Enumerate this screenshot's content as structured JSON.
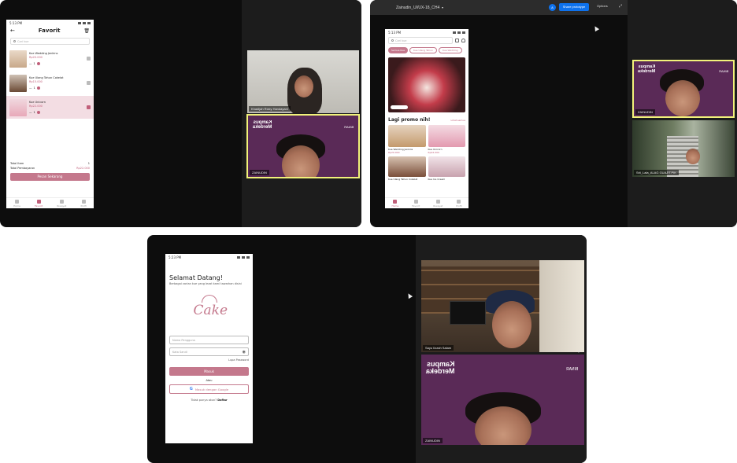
{
  "panel1": {
    "phone": {
      "time": "5:13 PM",
      "title": "Favorit",
      "search_placeholder": "Cari kue",
      "items": [
        {
          "name": "Kue Wedding Jenkins",
          "price": "Rp20.000",
          "qty": "1"
        },
        {
          "name": "Kue Ulang Tahun Cokelat",
          "price": "Rp15.000",
          "qty": "1"
        },
        {
          "name": "Kue Unicorn",
          "price": "Rp22.000",
          "qty": "1"
        }
      ],
      "total_item_label": "Total Item",
      "total_item_value": "1",
      "total_payment_label": "Total Pembayaran",
      "total_payment_value": "Rp22.000",
      "order_button": "Pesan Sekarang",
      "nav": [
        "Home",
        "Favorit",
        "Riwayat",
        "Profil"
      ]
    },
    "cams": [
      {
        "name": "Khadijah Rizky Handayani"
      },
      {
        "name": "ZAINUDIN"
      }
    ]
  },
  "panel2": {
    "title": "Zainudin_UI/UX-18_CH4",
    "share_button": "Share prototype",
    "options_label": "Options",
    "avatar_letter": "A",
    "phone": {
      "time": "5:13 PM",
      "search_placeholder": "Cari kue",
      "chips": [
        "Semua Kue",
        "Kue Ulang Tahun",
        "Kue Wedding"
      ],
      "promo_title": "Lagi promo nih!",
      "see_all": "Lihat semua",
      "products": [
        {
          "name": "Kue Wedding Jenkins",
          "price": "Rp20.000"
        },
        {
          "name": "Kue Unicorn",
          "price": "Rp22.000"
        },
        {
          "name": "Kue Ulang Tahun Cokelat",
          "price": ""
        },
        {
          "name": "Kue Ice Cream",
          "price": ""
        }
      ],
      "nav": [
        "Home",
        "Favorit",
        "Riwayat",
        "Profil"
      ]
    },
    "cams": [
      {
        "name": "ZAINUDIN"
      },
      {
        "name": "Srii_Lala_ALAG GUAJIT.PIK"
      }
    ]
  },
  "panel3": {
    "phone": {
      "time": "5:23 PM",
      "welcome": "Selamat Datang!",
      "subtitle": "Berbagai varian kue yang lezat kami tawarkan disini",
      "logo_text": "Cake",
      "username_placeholder": "Nama Pengguna",
      "password_placeholder": "Kata Sandi",
      "forgot": "Lupa Password",
      "login_button": "Masuk",
      "or": "Atau",
      "google_button": "Masuk dengan Google",
      "register_prompt": "Tidak punya akun?",
      "register_link": "Daftar"
    },
    "cams": [
      {
        "name": "Sayu Ilzzah Salam"
      },
      {
        "name": "ZAINUDIN"
      }
    ]
  },
  "brand": {
    "kampus_line1": "Kampus",
    "kampus_line2": "Merdeka",
    "binar": "BINAR"
  },
  "colors": {
    "accent": "#c4788c",
    "purple_bg": "#5a2a57",
    "zoom_blue": "#0e72ed",
    "highlight_border": "#f2f27a"
  }
}
